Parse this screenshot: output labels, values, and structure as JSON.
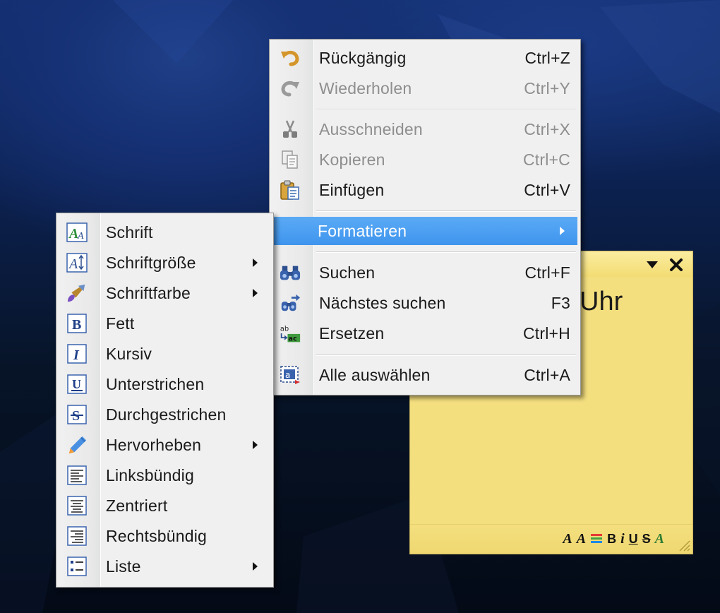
{
  "context_menu": {
    "items": [
      {
        "label": "Rückgängig",
        "shortcut": "Ctrl+Z",
        "icon": "undo-icon",
        "enabled": true
      },
      {
        "label": "Wiederholen",
        "shortcut": "Ctrl+Y",
        "icon": "redo-icon",
        "enabled": false
      },
      {
        "label": "Ausschneiden",
        "shortcut": "Ctrl+X",
        "icon": "scissors-icon",
        "enabled": false
      },
      {
        "label": "Kopieren",
        "shortcut": "Ctrl+C",
        "icon": "copy-icon",
        "enabled": false
      },
      {
        "label": "Einfügen",
        "shortcut": "Ctrl+V",
        "icon": "paste-icon",
        "enabled": true
      },
      {
        "label": "Formatieren",
        "icon": "none",
        "submenu": true,
        "highlighted": true
      },
      {
        "label": "Suchen",
        "shortcut": "Ctrl+F",
        "icon": "binoculars-icon",
        "enabled": true
      },
      {
        "label": "Nächstes suchen",
        "shortcut": "F3",
        "icon": "find-next-icon",
        "enabled": true
      },
      {
        "label": "Ersetzen",
        "shortcut": "Ctrl+H",
        "icon": "replace-icon",
        "enabled": true
      },
      {
        "label": "Alle auswählen",
        "shortcut": "Ctrl+A",
        "icon": "select-all-icon",
        "enabled": true
      }
    ]
  },
  "format_submenu": {
    "items": [
      {
        "label": "Schrift",
        "icon": "font-icon"
      },
      {
        "label": "Schriftgröße",
        "icon": "font-size-icon",
        "submenu": true
      },
      {
        "label": "Schriftfarbe",
        "icon": "font-color-brush-icon",
        "submenu": true
      },
      {
        "label": "Fett",
        "icon": "bold-icon"
      },
      {
        "label": "Kursiv",
        "icon": "italic-icon"
      },
      {
        "label": "Unterstrichen",
        "icon": "underline-icon"
      },
      {
        "label": "Durchgestrichen",
        "icon": "strikethrough-icon"
      },
      {
        "label": "Hervorheben",
        "icon": "highlighter-icon",
        "submenu": true
      },
      {
        "label": "Linksbündig",
        "icon": "align-left-icon"
      },
      {
        "label": "Zentriert",
        "icon": "align-center-icon"
      },
      {
        "label": "Rechtsbündig",
        "icon": "align-right-icon"
      },
      {
        "label": "Liste",
        "icon": "bullet-list-icon",
        "submenu": true
      }
    ]
  },
  "sticky_note": {
    "text": "Uhr",
    "toolbar": [
      "A",
      "A",
      "B",
      "i",
      "U",
      "S",
      "A"
    ],
    "colors": {
      "background": "#f4df7f",
      "border": "#c8b25c"
    }
  },
  "colors": {
    "highlight": "#3f95ee",
    "menu_bg": "#f0f0f0",
    "disabled_text": "#8e8e8e"
  }
}
